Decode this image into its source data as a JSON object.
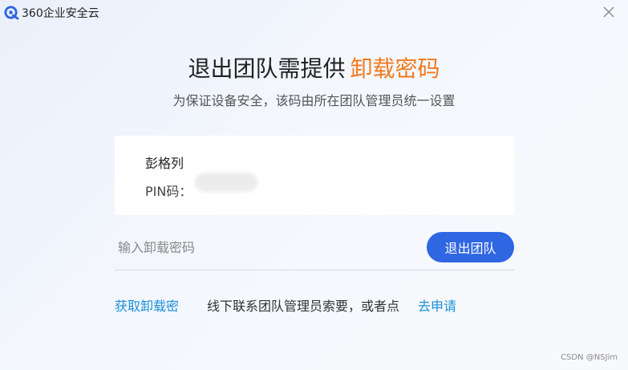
{
  "window": {
    "app_title": "360企业安全云",
    "icons": {
      "logo": "360-enterprise-cloud-logo-icon",
      "close": "close-icon"
    }
  },
  "header": {
    "title_main": "退出团队需提供",
    "title_accent": "卸载密码",
    "subtitle": "为保证设备安全，该码由所在团队管理员统一设置"
  },
  "info_card": {
    "user_name": "彭格列",
    "pin_label": "PIN码："
  },
  "form": {
    "password_placeholder": "输入卸载密码",
    "password_value": "",
    "exit_button_label": "退出团队"
  },
  "footer": {
    "get_password_link": "获取卸载密",
    "hint_text": "线下联系团队管理员索要，或者点",
    "apply_link": "去申请"
  },
  "watermark": "CSDN @NSJim",
  "colors": {
    "accent_orange": "#f0791e",
    "primary_blue": "#2f66e2",
    "link_blue": "#1a8fd8"
  }
}
